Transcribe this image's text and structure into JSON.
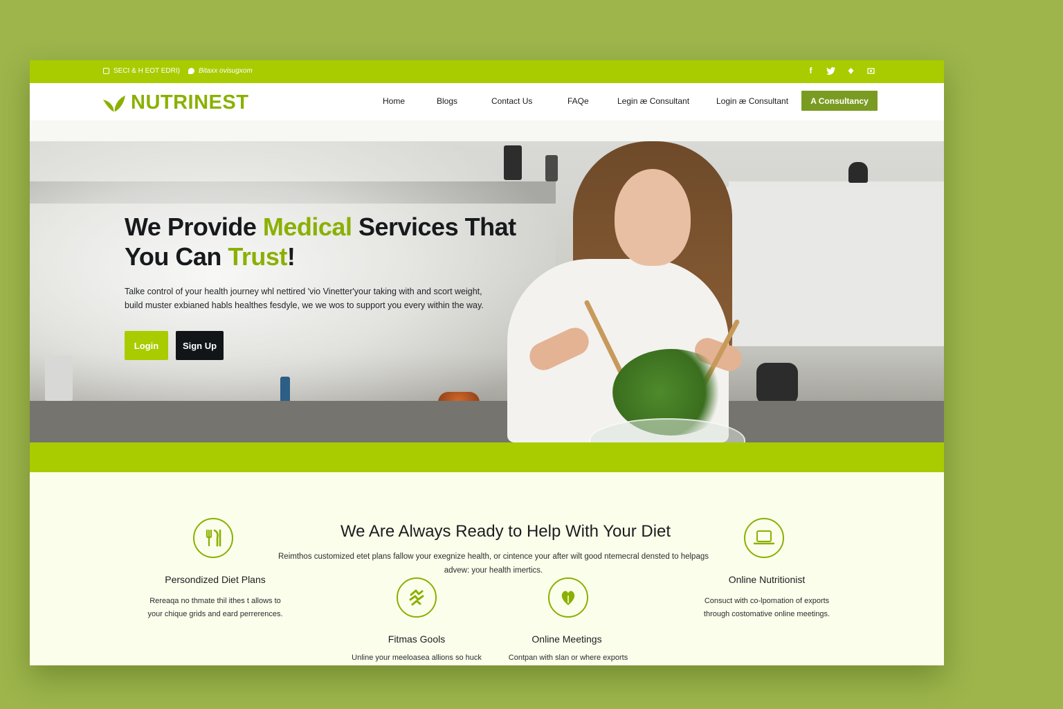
{
  "topbar": {
    "contact_1": "SECI & H EOT EDRI)",
    "contact_2": "Bitaxx ovisugxom",
    "social": [
      "facebook-icon",
      "twitter-icon",
      "instagram-icon",
      "mail-icon"
    ]
  },
  "brand": {
    "name": "NUTRINEST",
    "color": "#8ab000"
  },
  "nav": {
    "items": [
      "Home",
      "Blogs",
      "Contact Us",
      "FAQe",
      "Legin æ Consultant",
      "Login æ Consultant"
    ],
    "cta": "A Consultancy"
  },
  "hero": {
    "title_part1": "We Provide ",
    "title_highlight1": "Medical",
    "title_part2": " Services That",
    "title_part3": "You Can ",
    "title_highlight2": "Trust",
    "title_part4": "!",
    "subtitle_line1": "Talke control of your health  journey whl nettired 'vio Vinetter'your taking with and scort weight,",
    "subtitle_line2": "build muster exbianed habls healthes fesdyle, we we wos to support you every within the way.",
    "login_button": "Login",
    "signup_button": "Sign Up"
  },
  "services": {
    "title": "We Are Always Ready to Help With Your Diet",
    "description": "Reimthos customized etet plans fallow your exegnize health, or cintence your after wilt good ntemecral densted to helpags advew: your health imertics.",
    "features": [
      {
        "name": "Persondized Diet Plans",
        "text_line1": "Rereaqa no thmate thil ithes t allows to",
        "text_line2": "your chique grids and eard perrerences.",
        "icon": "fork-knife-icon"
      },
      {
        "name": "Online Nutritionist",
        "text_line1": "Consuct with co-lpomation of exports",
        "text_line2": "through costomative online meetings.",
        "icon": "laptop-icon"
      },
      {
        "name": "Fitmas Gools",
        "text_line1": "Unline your meeloasea allions so huck",
        "icon": "fitness-icon"
      },
      {
        "name": "Online Meetings",
        "text_line1": "Contpan with slan or where exports",
        "icon": "heart-leaf-icon"
      }
    ]
  },
  "colors": {
    "accent": "#a8cc00",
    "accent_dark": "#7a9b22",
    "dark": "#111517"
  }
}
